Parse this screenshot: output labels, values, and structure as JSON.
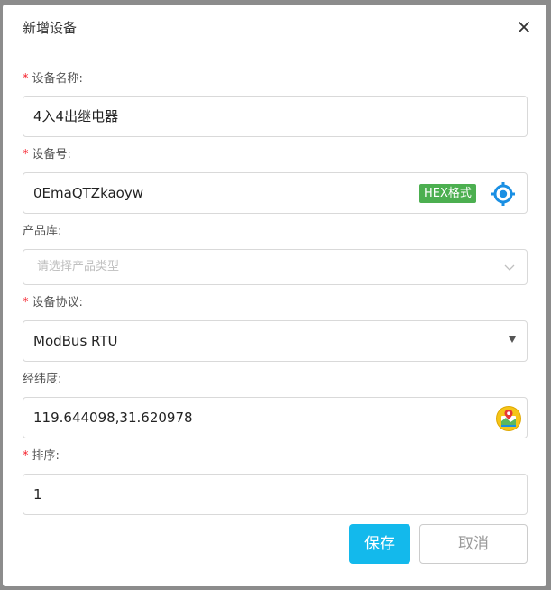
{
  "dialog": {
    "title": "新增设备"
  },
  "form": {
    "device_name": {
      "required_mark": "*",
      "label": "设备名称:",
      "value": "4入4出继电器"
    },
    "device_id": {
      "required_mark": "*",
      "label": "设备号:",
      "value": "0EmaQTZkaoyw",
      "badge": "HEX格式"
    },
    "product_lib": {
      "label": "产品库:",
      "placeholder": "请选择产品类型"
    },
    "protocol": {
      "required_mark": "*",
      "label": "设备协议:",
      "value": "ModBus RTU"
    },
    "coords": {
      "label": "经纬度:",
      "value": "119.644098,31.620978"
    },
    "sort": {
      "required_mark": "*",
      "label": "排序:",
      "value": "1"
    }
  },
  "buttons": {
    "save": "保存",
    "cancel": "取消"
  },
  "icons": {
    "close": "close-icon",
    "locate": "crosshair-icon",
    "map": "map-pin-icon",
    "chevron": "chevron-down-icon",
    "caret": "caret-down-icon"
  },
  "colors": {
    "primary": "#13b9ec",
    "badge": "#4caf50",
    "required": "#f5222d",
    "locate": "#1a8fe3"
  }
}
